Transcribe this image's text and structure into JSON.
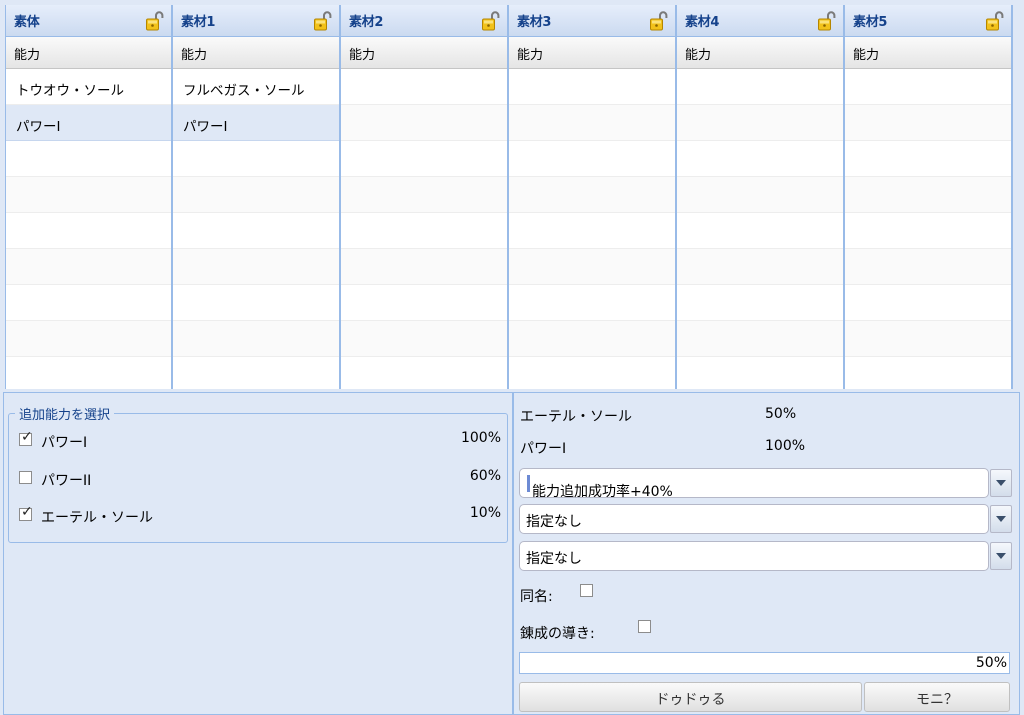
{
  "grids": [
    {
      "title": "素体",
      "header": "能力",
      "rows": [
        "トウオウ・ソール",
        "パワーI"
      ],
      "selected_row": 1
    },
    {
      "title": "素材1",
      "header": "能力",
      "rows": [
        "フルベガス・ソール",
        "パワーI"
      ],
      "selected_row": 1
    },
    {
      "title": "素材2",
      "header": "能力",
      "rows": [],
      "selected_row": -1
    },
    {
      "title": "素材3",
      "header": "能力",
      "rows": [],
      "selected_row": -1
    },
    {
      "title": "素材4",
      "header": "能力",
      "rows": [],
      "selected_row": -1
    },
    {
      "title": "素材5",
      "header": "能力",
      "rows": [],
      "selected_row": -1
    }
  ],
  "row_count": 9,
  "lock_icon": "unlocked-padlock-icon",
  "select_panel": {
    "legend": "追加能力を選択",
    "options": [
      {
        "label": "パワーI",
        "percent": "100%",
        "checked": true
      },
      {
        "label": "パワーII",
        "percent": "60%",
        "checked": false
      },
      {
        "label": "エーテル・ソール",
        "percent": "10%",
        "checked": true
      }
    ]
  },
  "result_panel": {
    "rates": [
      {
        "name": "エーテル・ソール",
        "value": "50%"
      },
      {
        "name": "パワーI",
        "value": "100%"
      }
    ],
    "combos": [
      {
        "value": "能力追加成功率+40%",
        "focused": true
      },
      {
        "value": "指定なし",
        "focused": false
      },
      {
        "value": "指定なし",
        "focused": false
      }
    ],
    "same_name_label": "同名:",
    "guidance_label": "錬成の導き:",
    "progress_text": "50%",
    "progress_value": 0.5,
    "buttons": [
      "ドゥドゥる",
      "モニ？"
    ]
  },
  "colors": {
    "accent": "#15428b",
    "border": "#99bbe8",
    "panel_bg": "#dfe8f6",
    "selected_row": "#dfe8f6"
  }
}
